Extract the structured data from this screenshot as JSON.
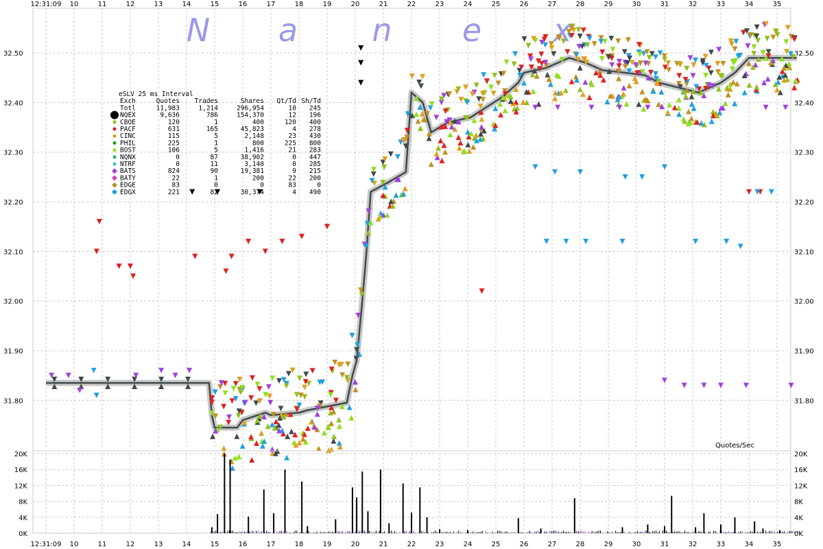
{
  "chart_data": [
    {
      "type": "scatter",
      "title": "eSLV 25 ms Interval",
      "watermark_letters": [
        "N",
        "a",
        "n",
        "e",
        "x"
      ],
      "x_tick_labels": [
        "12:31:09",
        "10",
        "11",
        "12",
        "13",
        "14",
        "15",
        "16",
        "17",
        "18",
        "19",
        "20",
        "21",
        "22",
        "23",
        "24",
        "25",
        "26",
        "27",
        "28",
        "29",
        "30",
        "31",
        "32",
        "33",
        "34",
        "35"
      ],
      "x_start_label": "12:31:09",
      "xlim": [
        9,
        35.9
      ],
      "ylim": [
        31.705,
        32.59
      ],
      "y_ticks": [
        31.8,
        31.9,
        32.0,
        32.1,
        32.2,
        32.3,
        32.4,
        32.5
      ],
      "y_tick_labels": [
        "31.80",
        "31.90",
        "32.00",
        "32.10",
        "32.20",
        "32.30",
        "32.40",
        "32.50"
      ],
      "grid": true,
      "legend_placement": "top-left",
      "legend_header": [
        "Exch",
        "Quotes",
        "Trades",
        "Shares",
        "Qt/Td",
        "Sh/Td"
      ],
      "legend_rows": [
        {
          "exch": "Totl",
          "quotes": "11,983",
          "trades": "1,214",
          "shares": "296,954",
          "qt_td": "10",
          "sh_td": "245",
          "color": ""
        },
        {
          "exch": "NQEX",
          "quotes": "9,636",
          "trades": "786",
          "shares": "154,370",
          "qt_td": "12",
          "sh_td": "196",
          "color": "#000000"
        },
        {
          "exch": "CBOE",
          "quotes": "120",
          "trades": "1",
          "shares": "400",
          "qt_td": "120",
          "sh_td": "400",
          "color": "#90c020"
        },
        {
          "exch": "PACF",
          "quotes": "631",
          "trades": "165",
          "shares": "45,823",
          "qt_td": "4",
          "sh_td": "278",
          "color": "#e02020"
        },
        {
          "exch": "CINC",
          "quotes": "115",
          "trades": "5",
          "shares": "2,148",
          "qt_td": "23",
          "sh_td": "430",
          "color": "#e0a020"
        },
        {
          "exch": "PHIL",
          "quotes": "225",
          "trades": "1",
          "shares": "800",
          "qt_td": "225",
          "sh_td": "800",
          "color": "#20a020"
        },
        {
          "exch": "BOST",
          "quotes": "106",
          "trades": "5",
          "shares": "1,416",
          "qt_td": "21",
          "sh_td": "283",
          "color": "#90e020"
        },
        {
          "exch": "NQNX",
          "quotes": "0",
          "trades": "87",
          "shares": "38,902",
          "qt_td": "0",
          "sh_td": "447",
          "color": "#20c060"
        },
        {
          "exch": "NTRF",
          "quotes": "0",
          "trades": "11",
          "shares": "3,140",
          "qt_td": "0",
          "sh_td": "285",
          "color": "#40c0c0"
        },
        {
          "exch": "BATS",
          "quotes": "824",
          "trades": "90",
          "shares": "19,381",
          "qt_td": "9",
          "sh_td": "215",
          "color": "#a040e0"
        },
        {
          "exch": "BATY",
          "quotes": "22",
          "trades": "1",
          "shares": "200",
          "qt_td": "22",
          "sh_td": "200",
          "color": "#e040c0"
        },
        {
          "exch": "EDGE",
          "quotes": "83",
          "trades": "0",
          "shares": "0",
          "qt_td": "83",
          "sh_td": "0",
          "color": "#c09020"
        },
        {
          "exch": "EDGX",
          "quotes": "221",
          "trades": "82",
          "shares": "30,374",
          "qt_td": "4",
          "sh_td": "490",
          "color": "#20a0e0"
        }
      ],
      "nbbo_mid": [
        {
          "x": 9.0,
          "y": 31.835
        },
        {
          "x": 14.8,
          "y": 31.835
        },
        {
          "x": 14.9,
          "y": 31.77
        },
        {
          "x": 15.0,
          "y": 31.745
        },
        {
          "x": 15.8,
          "y": 31.745
        },
        {
          "x": 16.0,
          "y": 31.76
        },
        {
          "x": 16.8,
          "y": 31.775
        },
        {
          "x": 17.0,
          "y": 31.77
        },
        {
          "x": 18.0,
          "y": 31.775
        },
        {
          "x": 18.3,
          "y": 31.78
        },
        {
          "x": 19.7,
          "y": 31.795
        },
        {
          "x": 19.9,
          "y": 31.85
        },
        {
          "x": 20.05,
          "y": 31.88
        },
        {
          "x": 20.25,
          "y": 32.0
        },
        {
          "x": 20.4,
          "y": 32.1
        },
        {
          "x": 20.55,
          "y": 32.22
        },
        {
          "x": 21.2,
          "y": 32.24
        },
        {
          "x": 21.8,
          "y": 32.26
        },
        {
          "x": 22.0,
          "y": 32.42
        },
        {
          "x": 22.4,
          "y": 32.4
        },
        {
          "x": 22.7,
          "y": 32.34
        },
        {
          "x": 23.3,
          "y": 32.36
        },
        {
          "x": 24.1,
          "y": 32.37
        },
        {
          "x": 25.2,
          "y": 32.41
        },
        {
          "x": 25.8,
          "y": 32.44
        },
        {
          "x": 26.0,
          "y": 32.46
        },
        {
          "x": 26.8,
          "y": 32.47
        },
        {
          "x": 27.6,
          "y": 32.49
        },
        {
          "x": 28.2,
          "y": 32.48
        },
        {
          "x": 28.8,
          "y": 32.465
        },
        {
          "x": 29.6,
          "y": 32.46
        },
        {
          "x": 30.3,
          "y": 32.455
        },
        {
          "x": 30.8,
          "y": 32.44
        },
        {
          "x": 31.5,
          "y": 32.43
        },
        {
          "x": 32.2,
          "y": 32.42
        },
        {
          "x": 33.0,
          "y": 32.44
        },
        {
          "x": 33.5,
          "y": 32.46
        },
        {
          "x": 34.0,
          "y": 32.49
        },
        {
          "x": 35.0,
          "y": 32.49
        },
        {
          "x": 35.7,
          "y": 32.49
        }
      ],
      "isolated_quotes": [
        {
          "x": 9.2,
          "y": 31.85,
          "exch": "BATS"
        },
        {
          "x": 9.8,
          "y": 31.85,
          "exch": "BATS"
        },
        {
          "x": 10.2,
          "y": 31.82,
          "exch": "BATS"
        },
        {
          "x": 10.7,
          "y": 31.86,
          "exch": "EDGX"
        },
        {
          "x": 10.8,
          "y": 31.81,
          "exch": "EDGX"
        },
        {
          "x": 12.2,
          "y": 31.85,
          "exch": "BATS"
        },
        {
          "x": 13.1,
          "y": 31.86,
          "exch": "BATS"
        },
        {
          "x": 13.6,
          "y": 31.85,
          "exch": "BATS"
        },
        {
          "x": 14.1,
          "y": 31.86,
          "exch": "BATS"
        },
        {
          "x": 10.9,
          "y": 32.16,
          "exch": "PACF"
        },
        {
          "x": 10.8,
          "y": 32.1,
          "exch": "PACF"
        },
        {
          "x": 11.6,
          "y": 32.07,
          "exch": "PACF"
        },
        {
          "x": 12.0,
          "y": 32.07,
          "exch": "PACF"
        },
        {
          "x": 12.1,
          "y": 32.05,
          "exch": "PACF"
        },
        {
          "x": 14.3,
          "y": 32.09,
          "exch": "PACF"
        },
        {
          "x": 15.6,
          "y": 32.09,
          "exch": "PACF"
        },
        {
          "x": 16.2,
          "y": 32.12,
          "exch": "PACF"
        },
        {
          "x": 17.4,
          "y": 32.12,
          "exch": "PACF"
        },
        {
          "x": 18.1,
          "y": 32.13,
          "exch": "PACF"
        },
        {
          "x": 19.0,
          "y": 32.15,
          "exch": "PACF"
        },
        {
          "x": 16.8,
          "y": 32.1,
          "exch": "PACF"
        },
        {
          "x": 15.4,
          "y": 32.06,
          "exch": "PACF"
        },
        {
          "x": 24.5,
          "y": 32.02,
          "exch": "PACF"
        },
        {
          "x": 34.4,
          "y": 32.22,
          "exch": "PACF"
        },
        {
          "x": 34.0,
          "y": 32.22,
          "exch": "PACF"
        },
        {
          "x": 26.4,
          "y": 32.27,
          "exch": "EDGX"
        },
        {
          "x": 27.1,
          "y": 32.26,
          "exch": "EDGX"
        },
        {
          "x": 28.0,
          "y": 32.26,
          "exch": "EDGX"
        },
        {
          "x": 29.6,
          "y": 32.25,
          "exch": "EDGX"
        },
        {
          "x": 30.2,
          "y": 32.25,
          "exch": "EDGX"
        },
        {
          "x": 31.0,
          "y": 32.27,
          "exch": "EDGX"
        },
        {
          "x": 34.3,
          "y": 32.22,
          "exch": "EDGX"
        },
        {
          "x": 34.8,
          "y": 32.22,
          "exch": "EDGX"
        },
        {
          "x": 26.8,
          "y": 32.12,
          "exch": "EDGX"
        },
        {
          "x": 27.5,
          "y": 32.12,
          "exch": "EDGX"
        },
        {
          "x": 28.2,
          "y": 32.12,
          "exch": "EDGX"
        },
        {
          "x": 29.5,
          "y": 32.12,
          "exch": "EDGX"
        },
        {
          "x": 32.1,
          "y": 32.12,
          "exch": "EDGX"
        },
        {
          "x": 33.2,
          "y": 32.12,
          "exch": "EDGX"
        },
        {
          "x": 33.7,
          "y": 32.11,
          "exch": "EDGX"
        },
        {
          "x": 31.0,
          "y": 31.84,
          "exch": "BATS"
        },
        {
          "x": 31.7,
          "y": 31.83,
          "exch": "BATS"
        },
        {
          "x": 32.4,
          "y": 31.83,
          "exch": "BATS"
        },
        {
          "x": 33.0,
          "y": 31.83,
          "exch": "BATS"
        },
        {
          "x": 33.9,
          "y": 31.83,
          "exch": "BATS"
        },
        {
          "x": 35.5,
          "y": 31.83,
          "exch": "BATS"
        },
        {
          "x": 26.4,
          "y": 32.39,
          "exch": "BATS"
        },
        {
          "x": 27.2,
          "y": 32.39,
          "exch": "BATS"
        },
        {
          "x": 28.4,
          "y": 32.39,
          "exch": "BATS"
        },
        {
          "x": 29.4,
          "y": 32.39,
          "exch": "BATS"
        },
        {
          "x": 30.4,
          "y": 32.39,
          "exch": "BATS"
        },
        {
          "x": 34.6,
          "y": 32.39,
          "exch": "BATS"
        },
        {
          "x": 35.3,
          "y": 32.39,
          "exch": "BATS"
        },
        {
          "x": 14.2,
          "y": 32.22,
          "exch": "NQEX"
        },
        {
          "x": 15.1,
          "y": 32.22,
          "exch": "NQEX"
        },
        {
          "x": 16.6,
          "y": 32.22,
          "exch": "NQEX"
        },
        {
          "x": 20.2,
          "y": 32.51,
          "exch": "NQEX"
        },
        {
          "x": 20.2,
          "y": 32.48,
          "exch": "NQEX"
        },
        {
          "x": 20.2,
          "y": 32.44,
          "exch": "NQEX"
        }
      ],
      "volume_panel": {
        "ylabel": "Quotes/Sec",
        "y_tick_labels": [
          "0K",
          "4K",
          "8K",
          "12K",
          "16K",
          "20K"
        ],
        "ylim": [
          0,
          20000
        ],
        "spikes": [
          {
            "x": 14.9,
            "y": 1500
          },
          {
            "x": 15.1,
            "y": 4800
          },
          {
            "x": 15.35,
            "y": 20000
          },
          {
            "x": 15.55,
            "y": 18500
          },
          {
            "x": 16.2,
            "y": 4200
          },
          {
            "x": 16.75,
            "y": 11000
          },
          {
            "x": 17.1,
            "y": 5000
          },
          {
            "x": 17.5,
            "y": 16000
          },
          {
            "x": 18.1,
            "y": 13000
          },
          {
            "x": 18.3,
            "y": 1800
          },
          {
            "x": 19.3,
            "y": 3500
          },
          {
            "x": 19.9,
            "y": 11500
          },
          {
            "x": 20.05,
            "y": 9000
          },
          {
            "x": 20.25,
            "y": 15500
          },
          {
            "x": 20.45,
            "y": 5500
          },
          {
            "x": 20.9,
            "y": 16000
          },
          {
            "x": 21.2,
            "y": 2500
          },
          {
            "x": 21.7,
            "y": 12500
          },
          {
            "x": 22.0,
            "y": 5200
          },
          {
            "x": 22.3,
            "y": 11500
          },
          {
            "x": 22.55,
            "y": 4000
          },
          {
            "x": 23.0,
            "y": 1000
          },
          {
            "x": 24.0,
            "y": 800
          },
          {
            "x": 25.8,
            "y": 3800
          },
          {
            "x": 26.6,
            "y": 1200
          },
          {
            "x": 27.8,
            "y": 8800
          },
          {
            "x": 29.5,
            "y": 1500
          },
          {
            "x": 30.4,
            "y": 2200
          },
          {
            "x": 31.0,
            "y": 1800
          },
          {
            "x": 31.25,
            "y": 9400
          },
          {
            "x": 32.1,
            "y": 1500
          },
          {
            "x": 32.4,
            "y": 5000
          },
          {
            "x": 33.0,
            "y": 2200
          },
          {
            "x": 33.5,
            "y": 4000
          },
          {
            "x": 34.2,
            "y": 3000
          },
          {
            "x": 34.5,
            "y": 1200
          },
          {
            "x": 35.1,
            "y": 800
          }
        ]
      }
    }
  ]
}
